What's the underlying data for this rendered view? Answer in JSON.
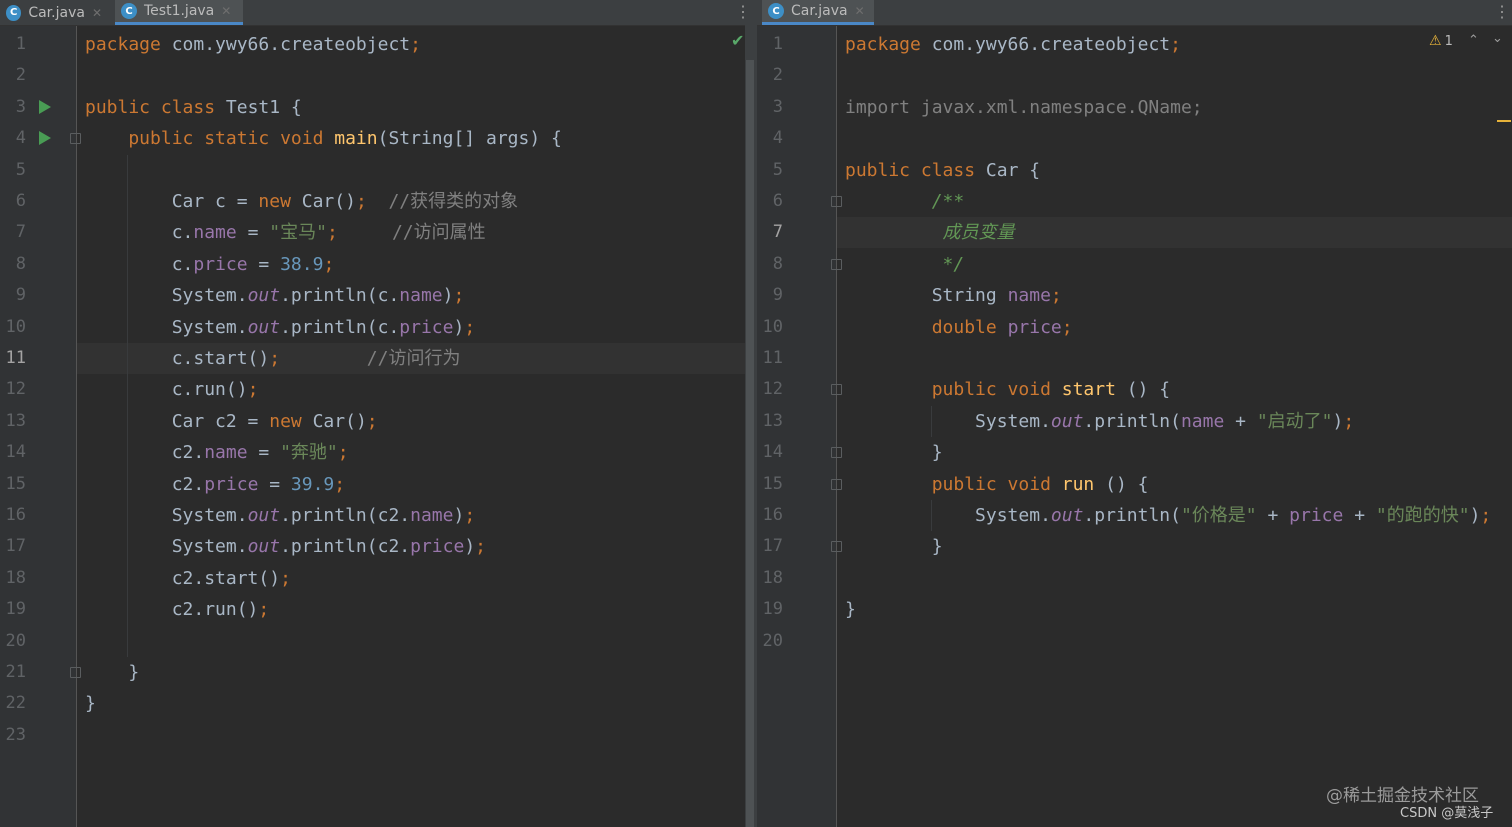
{
  "left": {
    "tabs": [
      {
        "label": "Car.java",
        "icon": "C",
        "active": false
      },
      {
        "label": "Test1.java",
        "icon": "C",
        "active": true
      }
    ],
    "current_line": 11,
    "line_numbers": [
      "1",
      "2",
      "3",
      "4",
      "5",
      "6",
      "7",
      "8",
      "9",
      "10",
      "11",
      "12",
      "13",
      "14",
      "15",
      "16",
      "17",
      "18",
      "19",
      "20",
      "21",
      "22",
      "23"
    ],
    "code": [
      [
        {
          "t": "package ",
          "c": "k"
        },
        {
          "t": "com.ywy66.createobject"
        },
        {
          "t": ";",
          "c": "k"
        }
      ],
      [],
      [
        {
          "t": "public class ",
          "c": "k"
        },
        {
          "t": "Test1 {"
        }
      ],
      [
        {
          "t": "    public static void ",
          "c": "k"
        },
        {
          "t": "main",
          "c": "m"
        },
        {
          "t": "(String[] args) {"
        }
      ],
      [],
      [
        {
          "t": "        Car c = "
        },
        {
          "t": "new ",
          "c": "k"
        },
        {
          "t": "Car()"
        },
        {
          "t": ";",
          "c": "k"
        },
        {
          "t": "  //获得类的对象",
          "c": "c"
        }
      ],
      [
        {
          "t": "        c."
        },
        {
          "t": "name",
          "c": "f"
        },
        {
          "t": " = "
        },
        {
          "t": "\"宝马\"",
          "c": "s"
        },
        {
          "t": ";",
          "c": "k"
        },
        {
          "t": "     //访问属性",
          "c": "c"
        }
      ],
      [
        {
          "t": "        c."
        },
        {
          "t": "price",
          "c": "f"
        },
        {
          "t": " = "
        },
        {
          "t": "38.9",
          "c": "n"
        },
        {
          "t": ";",
          "c": "k"
        }
      ],
      [
        {
          "t": "        System."
        },
        {
          "t": "out",
          "c": "fi"
        },
        {
          "t": ".println(c."
        },
        {
          "t": "name",
          "c": "f"
        },
        {
          "t": ")"
        },
        {
          "t": ";",
          "c": "k"
        }
      ],
      [
        {
          "t": "        System."
        },
        {
          "t": "out",
          "c": "fi"
        },
        {
          "t": ".println(c."
        },
        {
          "t": "price",
          "c": "f"
        },
        {
          "t": ")"
        },
        {
          "t": ";",
          "c": "k"
        }
      ],
      [
        {
          "t": "        c.start()"
        },
        {
          "t": ";",
          "c": "k"
        },
        {
          "t": "        //访问行为",
          "c": "c"
        }
      ],
      [
        {
          "t": "        c.run()"
        },
        {
          "t": ";",
          "c": "k"
        }
      ],
      [
        {
          "t": "        Car c2 = "
        },
        {
          "t": "new ",
          "c": "k"
        },
        {
          "t": "Car()"
        },
        {
          "t": ";",
          "c": "k"
        }
      ],
      [
        {
          "t": "        c2."
        },
        {
          "t": "name",
          "c": "f"
        },
        {
          "t": " = "
        },
        {
          "t": "\"奔驰\"",
          "c": "s"
        },
        {
          "t": ";",
          "c": "k"
        }
      ],
      [
        {
          "t": "        c2."
        },
        {
          "t": "price",
          "c": "f"
        },
        {
          "t": " = "
        },
        {
          "t": "39.9",
          "c": "n"
        },
        {
          "t": ";",
          "c": "k"
        }
      ],
      [
        {
          "t": "        System."
        },
        {
          "t": "out",
          "c": "fi"
        },
        {
          "t": ".println(c2."
        },
        {
          "t": "name",
          "c": "f"
        },
        {
          "t": ")"
        },
        {
          "t": ";",
          "c": "k"
        }
      ],
      [
        {
          "t": "        System."
        },
        {
          "t": "out",
          "c": "fi"
        },
        {
          "t": ".println(c2."
        },
        {
          "t": "price",
          "c": "f"
        },
        {
          "t": ")"
        },
        {
          "t": ";",
          "c": "k"
        }
      ],
      [
        {
          "t": "        c2.start()"
        },
        {
          "t": ";",
          "c": "k"
        }
      ],
      [
        {
          "t": "        c2.run()"
        },
        {
          "t": ";",
          "c": "k"
        }
      ],
      [],
      [
        {
          "t": "    }"
        }
      ],
      [
        {
          "t": "}"
        }
      ],
      []
    ],
    "run_lines": [
      3,
      4
    ],
    "fold_lines": [
      4,
      21
    ],
    "status_icon": "check-icon"
  },
  "right": {
    "tabs": [
      {
        "label": "Car.java",
        "icon": "C",
        "active": true
      }
    ],
    "current_line": 7,
    "line_numbers": [
      "1",
      "2",
      "3",
      "4",
      "5",
      "6",
      "7",
      "8",
      "9",
      "10",
      "11",
      "12",
      "13",
      "14",
      "15",
      "16",
      "17",
      "18",
      "19",
      "20"
    ],
    "code": [
      [
        {
          "t": "package ",
          "c": "k"
        },
        {
          "t": "com.ywy66.createobject"
        },
        {
          "t": ";",
          "c": "k"
        }
      ],
      [],
      [
        {
          "t": "import javax.xml.namespace.QName;",
          "c": "im"
        }
      ],
      [],
      [
        {
          "t": "public class ",
          "c": "k"
        },
        {
          "t": "Car {"
        }
      ],
      [
        {
          "t": "        /**",
          "c": "d"
        }
      ],
      [
        {
          "t": "         成员变量",
          "c": "d"
        }
      ],
      [
        {
          "t": "         */",
          "c": "d"
        }
      ],
      [
        {
          "t": "        String "
        },
        {
          "t": "name",
          "c": "f"
        },
        {
          "t": ";",
          "c": "k"
        }
      ],
      [
        {
          "t": "        double ",
          "c": "k"
        },
        {
          "t": "price",
          "c": "f"
        },
        {
          "t": ";",
          "c": "k"
        }
      ],
      [],
      [
        {
          "t": "        public void ",
          "c": "k"
        },
        {
          "t": "start",
          "c": "m"
        },
        {
          "t": " () {"
        }
      ],
      [
        {
          "t": "            System."
        },
        {
          "t": "out",
          "c": "fi"
        },
        {
          "t": ".println("
        },
        {
          "t": "name",
          "c": "f"
        },
        {
          "t": " + "
        },
        {
          "t": "\"启动了\"",
          "c": "s"
        },
        {
          "t": ")"
        },
        {
          "t": ";",
          "c": "k"
        }
      ],
      [
        {
          "t": "        }"
        }
      ],
      [
        {
          "t": "        public void ",
          "c": "k"
        },
        {
          "t": "run",
          "c": "m"
        },
        {
          "t": " () {"
        }
      ],
      [
        {
          "t": "            System."
        },
        {
          "t": "out",
          "c": "fi"
        },
        {
          "t": ".println("
        },
        {
          "t": "\"价格是\"",
          "c": "s"
        },
        {
          "t": " + "
        },
        {
          "t": "price",
          "c": "f"
        },
        {
          "t": " + "
        },
        {
          "t": "\"的跑的快\"",
          "c": "s"
        },
        {
          "t": ")"
        },
        {
          "t": ";",
          "c": "k"
        }
      ],
      [
        {
          "t": "        }"
        }
      ],
      [],
      [
        {
          "t": "}"
        }
      ],
      []
    ],
    "fold_lines": [
      6,
      8,
      12,
      14,
      15,
      17
    ],
    "warning_count": "1",
    "warning_icon": "warning-icon"
  },
  "watermark": {
    "line1": "@稀土掘金技术社区",
    "line2": "CSDN @莫浅子"
  }
}
